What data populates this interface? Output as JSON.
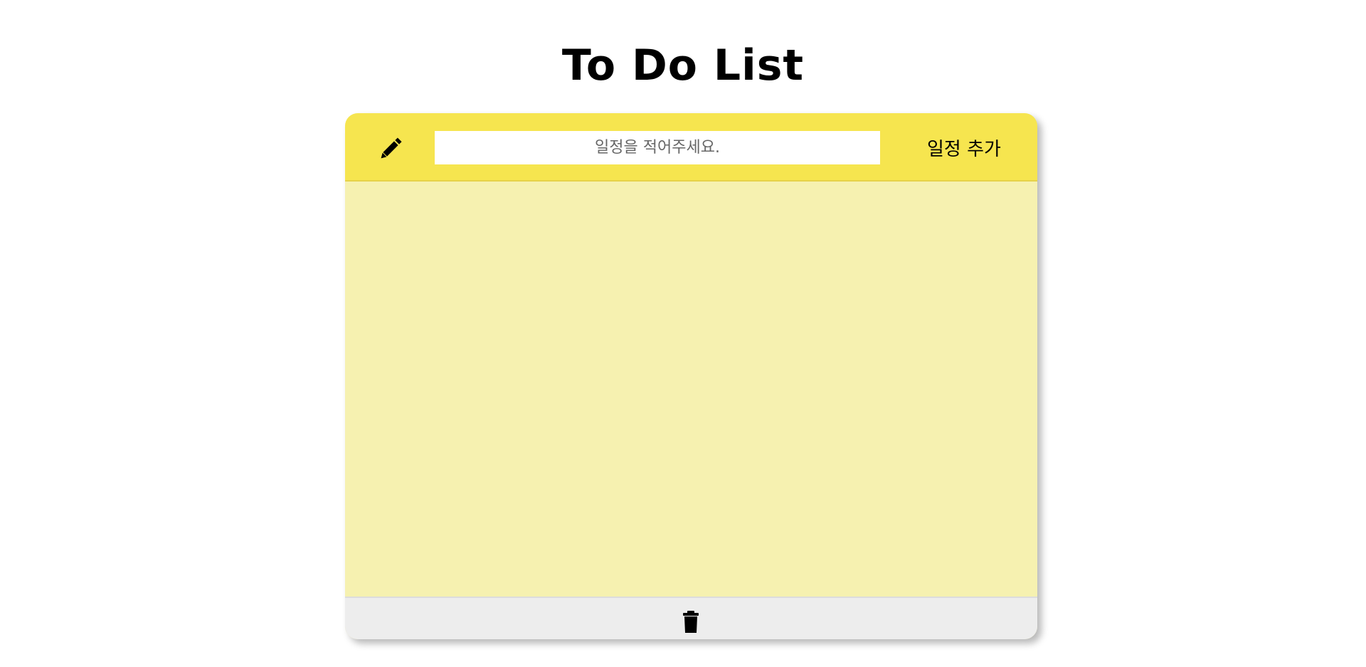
{
  "page": {
    "title": "To Do List"
  },
  "header": {
    "icon": "pencil-icon",
    "input_placeholder": "일정을 적어주세요.",
    "input_value": "",
    "add_button_label": "일정 추가"
  },
  "list": {
    "items": []
  },
  "footer": {
    "icon": "trash-icon"
  },
  "colors": {
    "header_bg": "#f6e54f",
    "list_bg": "#f6f1b0",
    "footer_bg": "#ededed",
    "text": "#000000"
  }
}
